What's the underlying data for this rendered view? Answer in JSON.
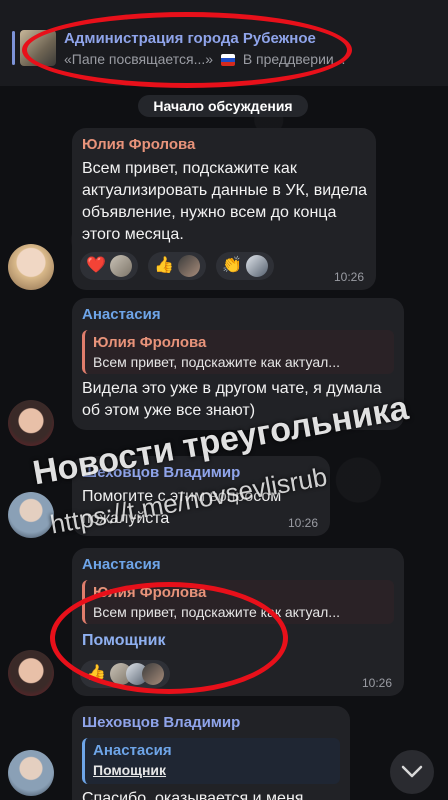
{
  "pinned": {
    "title": "Администрация города Рубежное",
    "preview_left": "«Папе посвящается...»",
    "preview_right": "В преддверии..."
  },
  "divider": "Начало обсуждения",
  "messages": [
    {
      "sender": "Юлия Фролова",
      "sender_color": "#e8937a",
      "text": "Всем привет, подскажите как актуализировать данные в УК, видела объявление, нужно всем до конца этого месяца.",
      "time": "10:26",
      "reactions": [
        "❤️",
        "👍",
        "👏"
      ]
    },
    {
      "sender": "Анастасия",
      "sender_color": "#6ea5e8",
      "reply_name": "Юлия Фролова",
      "reply_text": "Всем привет, подскажите как актуал...",
      "text": "Видела это уже в другом чате, я думала об этом уже все знают)",
      "time": "10:26"
    },
    {
      "sender": "Шеховцов Владимир",
      "sender_color": "#8fa4ea",
      "text": "Помогите с этим вопросом пожалуйста",
      "time": "10:26"
    },
    {
      "sender": "Анастасия",
      "sender_color": "#6ea5e8",
      "reply_name": "Юлия Фролова",
      "reply_text": "Всем привет, подскажите как актуал...",
      "text": "Помощник",
      "time": "10:26",
      "reactions": [
        "👍"
      ]
    },
    {
      "sender": "Шеховцов Владимир",
      "sender_color": "#8fa4ea",
      "reply_name": "Анастасия",
      "reply_text": "Помощник",
      "text": "Спасибо, оказывается и меня"
    }
  ],
  "watermark": {
    "line1": "Новости треугольника",
    "line2": "https://t.me/novsevlisrub"
  },
  "colors": {
    "accent": "#8fa4ea",
    "bubble": "#212226",
    "annotation": "#e8101a"
  }
}
